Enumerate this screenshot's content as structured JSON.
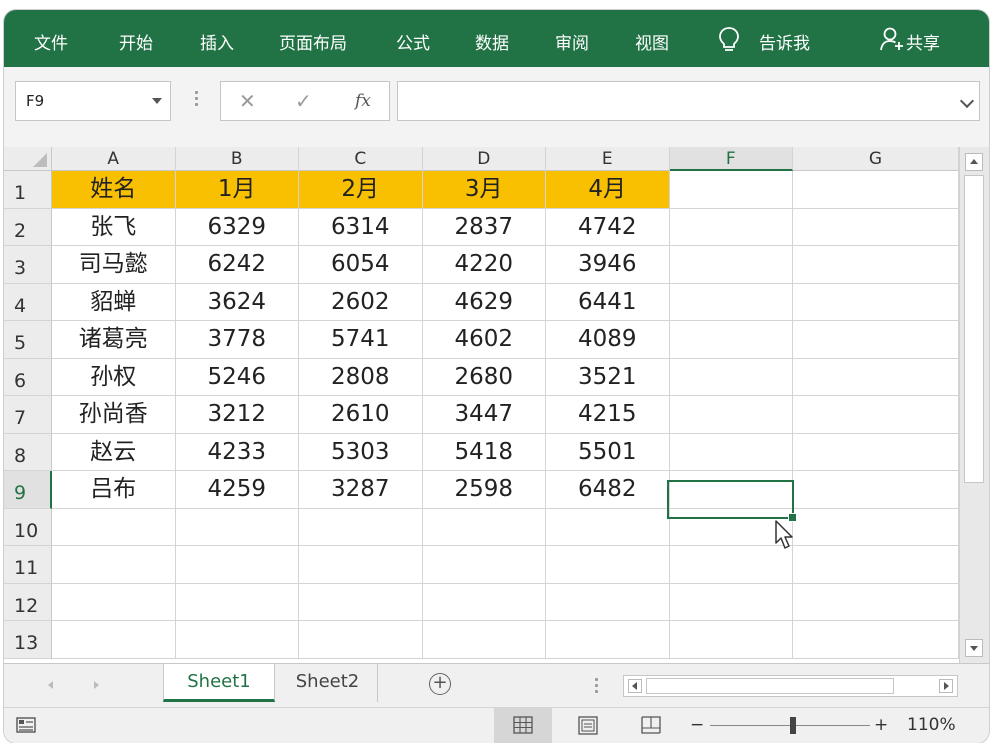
{
  "ribbon": {
    "tabs": [
      "文件",
      "开始",
      "插入",
      "页面布局",
      "公式",
      "数据",
      "审阅",
      "视图"
    ],
    "tell_me": "告诉我",
    "share": "共享",
    "accent": "#217346"
  },
  "formula_bar": {
    "name_box": "F9",
    "fx_label": "fx",
    "cancel_glyph": "✕",
    "enter_glyph": "✓",
    "formula": ""
  },
  "grid": {
    "columns": [
      "A",
      "B",
      "C",
      "D",
      "E",
      "F",
      "G"
    ],
    "rows": [
      "1",
      "2",
      "3",
      "4",
      "5",
      "6",
      "7",
      "8",
      "9",
      "10",
      "11",
      "12",
      "13"
    ],
    "header_fill": "#f8c000",
    "cells": [
      [
        "姓名",
        "1月",
        "2月",
        "3月",
        "4月"
      ],
      [
        "张飞",
        "6329",
        "6314",
        "2837",
        "4742"
      ],
      [
        "司马懿",
        "6242",
        "6054",
        "4220",
        "3946"
      ],
      [
        "貂蝉",
        "3624",
        "2602",
        "4629",
        "6441"
      ],
      [
        "诸葛亮",
        "3778",
        "5741",
        "4602",
        "4089"
      ],
      [
        "孙权",
        "5246",
        "2808",
        "2680",
        "3521"
      ],
      [
        "孙尚香",
        "3212",
        "2610",
        "3447",
        "4215"
      ],
      [
        "赵云",
        "4233",
        "5303",
        "5418",
        "5501"
      ],
      [
        "吕布",
        "4259",
        "3287",
        "2598",
        "6482"
      ]
    ],
    "active_cell": "F9"
  },
  "sheets": {
    "tabs": [
      "Sheet1",
      "Sheet2"
    ],
    "active": "Sheet1",
    "add_glyph": "+"
  },
  "status": {
    "zoom": "110%",
    "zoom_minus": "−",
    "zoom_plus": "+"
  }
}
